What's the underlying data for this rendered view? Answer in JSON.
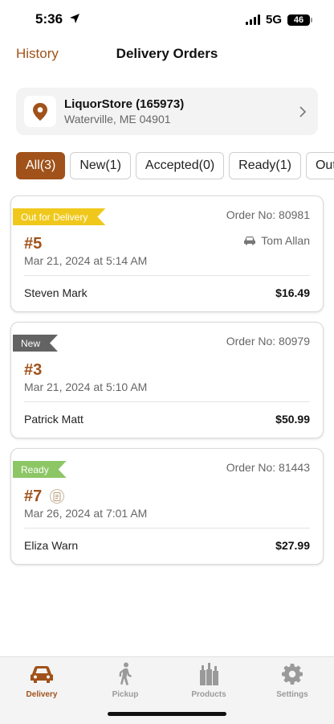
{
  "status_bar": {
    "time": "5:36",
    "network": "5G",
    "battery": "46"
  },
  "header": {
    "back_label": "History",
    "title": "Delivery Orders"
  },
  "store": {
    "name": "LiquorStore (165973)",
    "address": "Waterville, ME 04901",
    "icon": "location-pin-icon"
  },
  "filters": [
    {
      "label": "All(3)",
      "active": true
    },
    {
      "label": "New(1)",
      "active": false
    },
    {
      "label": "Accepted(0)",
      "active": false
    },
    {
      "label": "Ready(1)",
      "active": false
    },
    {
      "label": "Out",
      "active": false
    }
  ],
  "orders": [
    {
      "status": "Out for Delivery",
      "order_no": "Order No: 80981",
      "number": "#5",
      "date": "Mar 21, 2024 at 5:14 AM",
      "driver": "Tom Allan",
      "customer": "Steven Mark",
      "amount": "$16.49"
    },
    {
      "status": "New",
      "order_no": "Order No: 80979",
      "number": "#3",
      "date": "Mar 21, 2024 at 5:10 AM",
      "customer": "Patrick Matt",
      "amount": "$50.99"
    },
    {
      "status": "Ready",
      "order_no": "Order No: 81443",
      "number": "#7",
      "date": "Mar 26, 2024 at 7:01 AM",
      "customer": "Eliza Warn",
      "amount": "$27.99"
    }
  ],
  "tab_bar": [
    {
      "label": "Delivery",
      "icon": "car-icon",
      "active": true
    },
    {
      "label": "Pickup",
      "icon": "walking-person-icon",
      "active": false
    },
    {
      "label": "Products",
      "icon": "bottles-icon",
      "active": false
    },
    {
      "label": "Settings",
      "icon": "gear-icon",
      "active": false
    }
  ],
  "colors": {
    "accent": "#a0521a",
    "out_for_delivery": "#f0c81c",
    "new": "#636363",
    "ready": "#8cc665"
  }
}
